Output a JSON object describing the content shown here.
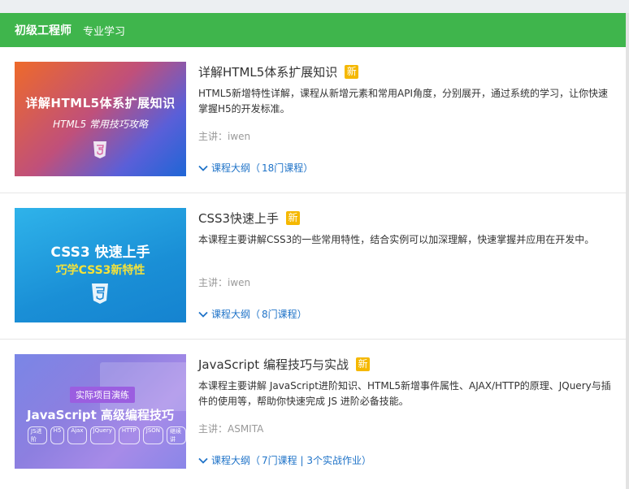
{
  "header": {
    "title": "初级工程师",
    "subtitle": "专业学习"
  },
  "courses": [
    {
      "title": "详解HTML5体系扩展知识",
      "badge": "新",
      "description": "HTML5新增特性详解，课程从新增元素和常用API角度，分别展开，通过系统的学习，让你快速掌握H5的开发标准。",
      "lecturer": "主讲：iwen",
      "outline_label": "课程大纲（",
      "outline_count": "18门课程",
      "outline_close": "）",
      "thumb_title": "详解HTML5体系扩展知识",
      "thumb_subtitle": "HTML5 常用技巧攻略"
    },
    {
      "title": "CSS3快速上手",
      "badge": "新",
      "description": "本课程主要讲解CSS3的一些常用特性，结合实例可以加深理解，快速掌握并应用在开发中。",
      "lecturer": "主讲：iwen",
      "outline_label": "课程大纲（",
      "outline_count": "8门课程",
      "outline_close": "）",
      "thumb_title": "CSS3 快速上手",
      "thumb_subtitle": "巧学CSS3新特性"
    },
    {
      "title": "JavaScript 编程技巧与实战",
      "badge": "新",
      "description": "本课程主要讲解 JavaScript进阶知识、HTML5新增事件属性、AJAX/HTTP的原理、JQuery与插件的使用等，帮助你快速完成 JS 进阶必备技能。",
      "lecturer": "主讲：ASMITA",
      "outline_label": "课程大纲（",
      "outline_count": "7门课程 | 3个实战作业",
      "outline_close": "）",
      "thumb_badge": "实际项目演练",
      "thumb_title": "JavaScript 高级编程技巧",
      "thumb_tags": [
        "JS进阶",
        "H5",
        "Ajax",
        "JQuery",
        "HTTP",
        "JSON",
        "继续讲"
      ]
    }
  ],
  "colors": {
    "header_bg": "#3fb54c",
    "badge": "#f5b800",
    "link": "#1f73c8"
  }
}
